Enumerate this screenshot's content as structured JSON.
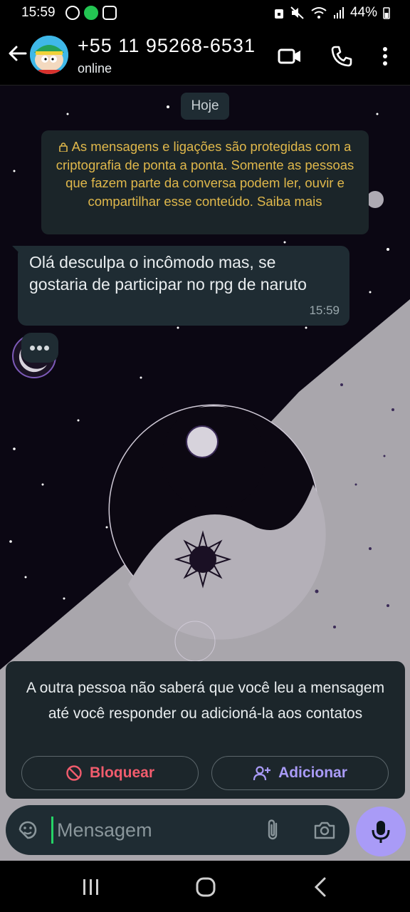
{
  "status_bar": {
    "time": "15:59",
    "battery": "44%"
  },
  "header": {
    "title": "+55 11 95268-6531",
    "subtitle": "online"
  },
  "chat": {
    "date_chip": "Hoje",
    "encryption_notice": "As mensagens e ligações são protegidas com a criptografia de ponta a ponta. Somente as pessoas que fazem parte da conversa podem ler, ouvir e compartilhar esse conteúdo. Saiba mais",
    "messages": [
      {
        "text": "Olá desculpa o incômodo mas, se gostaria de participar no rpg de naruto",
        "time": "15:59"
      }
    ]
  },
  "unknown_contact_card": {
    "text": "A outra pessoa não saberá que você leu a mensagem até você responder ou adicioná-la aos contatos",
    "block_label": "Bloquear",
    "add_label": "Adicionar"
  },
  "composer": {
    "placeholder": "Mensagem"
  },
  "colors": {
    "accent": "#a99bf7",
    "danger": "#f15c6d",
    "notice_text": "#e0b84b",
    "bubble": "#1f2c33"
  }
}
